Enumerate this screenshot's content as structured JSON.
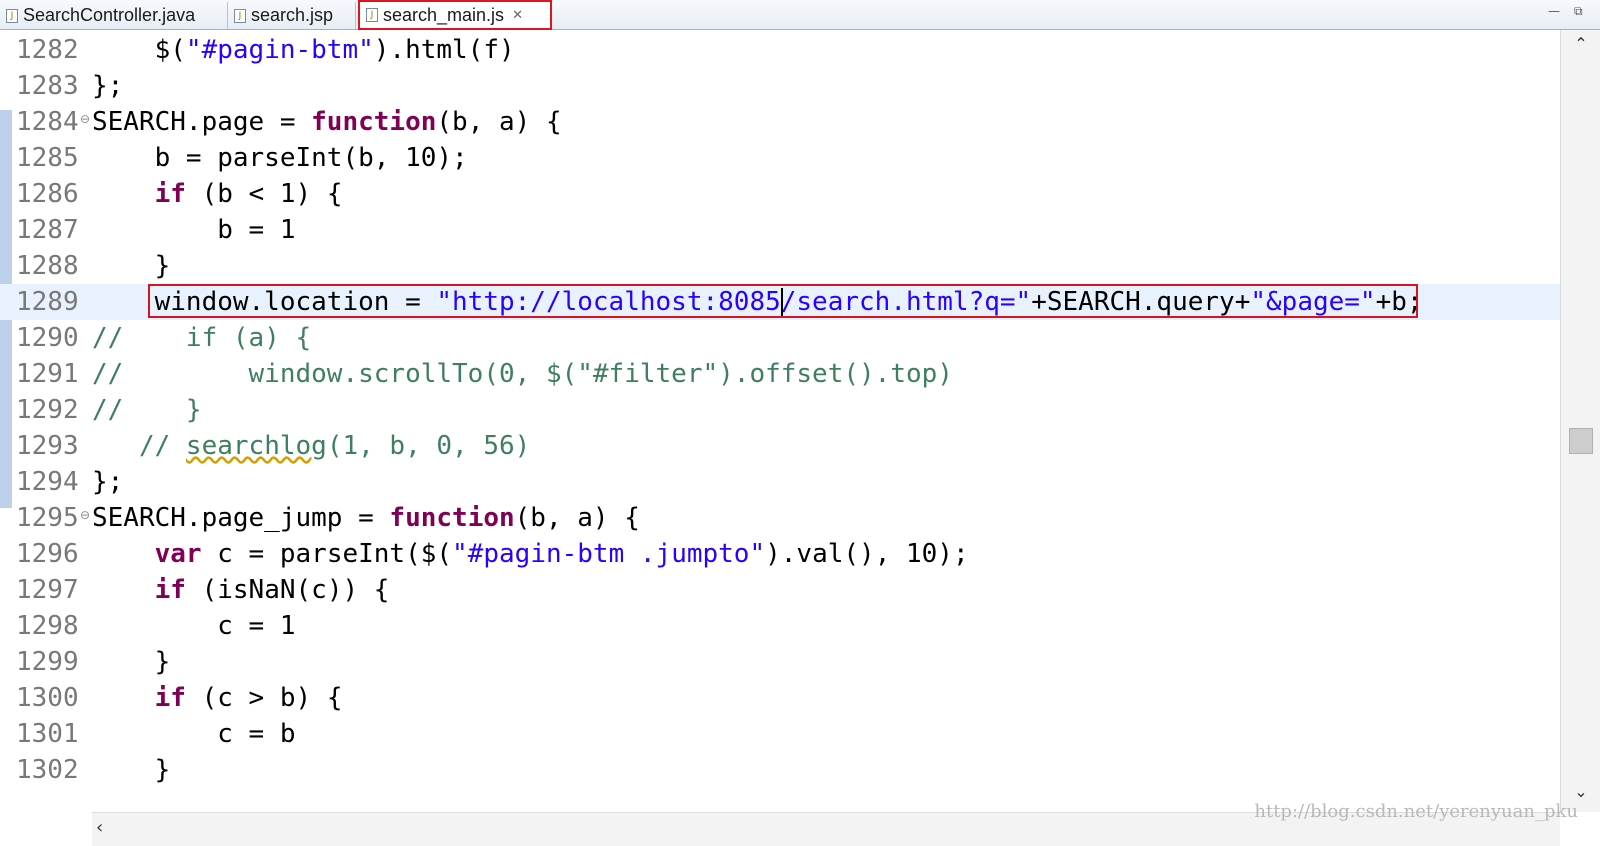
{
  "tabs": [
    {
      "label": "SearchController.java",
      "active": false
    },
    {
      "label": "search.jsp",
      "active": false
    },
    {
      "label": "search_main.js",
      "active": true
    }
  ],
  "window_controls": {
    "minimize": "—",
    "maximize": "⧉"
  },
  "editor": {
    "lines": [
      {
        "num": "1282",
        "code": "    $(\"#pagin-btm\").html(f)"
      },
      {
        "num": "1283",
        "code": "};"
      },
      {
        "num": "1284",
        "code": "SEARCH.page = function(b, a) {"
      },
      {
        "num": "1285",
        "code": "    b = parseInt(b, 10);"
      },
      {
        "num": "1286",
        "code": "    if (b < 1) {"
      },
      {
        "num": "1287",
        "code": "        b = 1"
      },
      {
        "num": "1288",
        "code": "    }"
      },
      {
        "num": "1289",
        "code": "    window.location = \"http://localhost:8085/search.html?q=\"+SEARCH.query+\"&page=\"+b;"
      },
      {
        "num": "1290",
        "code": "//    if (a) {"
      },
      {
        "num": "1291",
        "code": "//        window.scrollTo(0, $(\"#filter\").offset().top)"
      },
      {
        "num": "1292",
        "code": "//    }"
      },
      {
        "num": "1293",
        "code": "   // searchlog(1, b, 0, 56)"
      },
      {
        "num": "1294",
        "code": "};"
      },
      {
        "num": "1295",
        "code": "SEARCH.page_jump = function(b, a) {"
      },
      {
        "num": "1296",
        "code": "    var c = parseInt($(\"#pagin-btm .jumpto\").val(), 10);"
      },
      {
        "num": "1297",
        "code": "    if (isNaN(c)) {"
      },
      {
        "num": "1298",
        "code": "        c = 1"
      },
      {
        "num": "1299",
        "code": "    }"
      },
      {
        "num": "1300",
        "code": "    if (c > b) {"
      },
      {
        "num": "1301",
        "code": "        c = b"
      },
      {
        "num": "1302",
        "code": "    }"
      }
    ],
    "current_line": "1289",
    "highlighted_line": "1289",
    "collapsible_lines": [
      "1284",
      "1295"
    ]
  },
  "watermark": "http://blog.csdn.net/yerenyuan_pku",
  "colors": {
    "keyword": "#7f0055",
    "string": "#2a00ff",
    "comment": "#3f7f5f",
    "highlight_box": "#d9141e",
    "current_line_bg": "#e8f2fe"
  },
  "icons": {
    "tab_file": "js-file-icon",
    "tab_close": "close-icon",
    "scroll_up": "chevron-up-icon",
    "scroll_down": "chevron-down-icon",
    "scroll_left": "chevron-left-icon",
    "fold": "fold-collapse-icon"
  }
}
